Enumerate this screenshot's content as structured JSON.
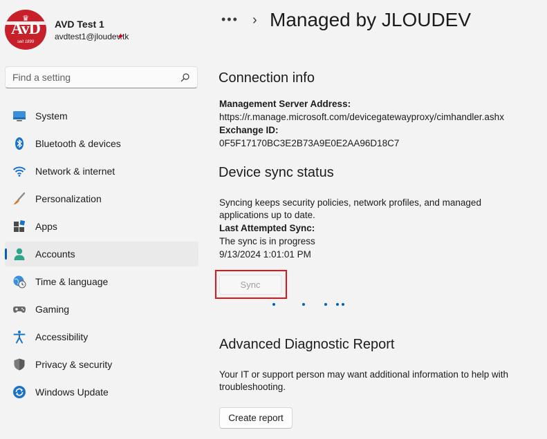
{
  "profile": {
    "name": "AVD Test 1",
    "email": "avdtest1@jloudev.tk",
    "logo": {
      "top": "♛",
      "mid": "AvD",
      "bottom": "seit 1899"
    }
  },
  "search": {
    "placeholder": "Find a setting",
    "icon": "search-icon"
  },
  "sidebar": {
    "items": [
      {
        "label": "System",
        "icon": "monitor-icon",
        "active": false
      },
      {
        "label": "Bluetooth & devices",
        "icon": "bluetooth-icon",
        "active": false
      },
      {
        "label": "Network & internet",
        "icon": "wifi-icon",
        "active": false
      },
      {
        "label": "Personalization",
        "icon": "brush-icon",
        "active": false
      },
      {
        "label": "Apps",
        "icon": "apps-icon",
        "active": false
      },
      {
        "label": "Accounts",
        "icon": "person-icon",
        "active": true
      },
      {
        "label": "Time & language",
        "icon": "globe-clock-icon",
        "active": false
      },
      {
        "label": "Gaming",
        "icon": "gamepad-icon",
        "active": false
      },
      {
        "label": "Accessibility",
        "icon": "accessibility-icon",
        "active": false
      },
      {
        "label": "Privacy & security",
        "icon": "shield-icon",
        "active": false
      },
      {
        "label": "Windows Update",
        "icon": "update-icon",
        "active": false
      }
    ]
  },
  "header": {
    "dots": "•••",
    "chevron": "›",
    "title": "Managed by JLOUDEV"
  },
  "connection": {
    "title": "Connection info",
    "server_label": "Management Server Address:",
    "server_value": "https://r.manage.microsoft.com/devicegatewayproxy/cimhandler.ashx",
    "exchange_label": "Exchange ID:",
    "exchange_value": "0F5F17170BC3E2B73A9E0E2AA96D18C7"
  },
  "sync": {
    "title": "Device sync status",
    "desc_line1": "Syncing keeps security policies, network profiles, and managed",
    "desc_line2": "applications up to date.",
    "last_label": "Last Attempted Sync:",
    "status": "The sync is in progress",
    "timestamp": "9/13/2024 1:01:01 PM",
    "button": "Sync"
  },
  "diagnostic": {
    "title": "Advanced Diagnostic Report",
    "desc_line1": "Your IT or support person may want additional information to help with",
    "desc_line2": "troubleshooting.",
    "button": "Create report"
  },
  "colors": {
    "accent": "#005fb8",
    "highlight": "#e0141b",
    "background": "#f3f3f3"
  }
}
